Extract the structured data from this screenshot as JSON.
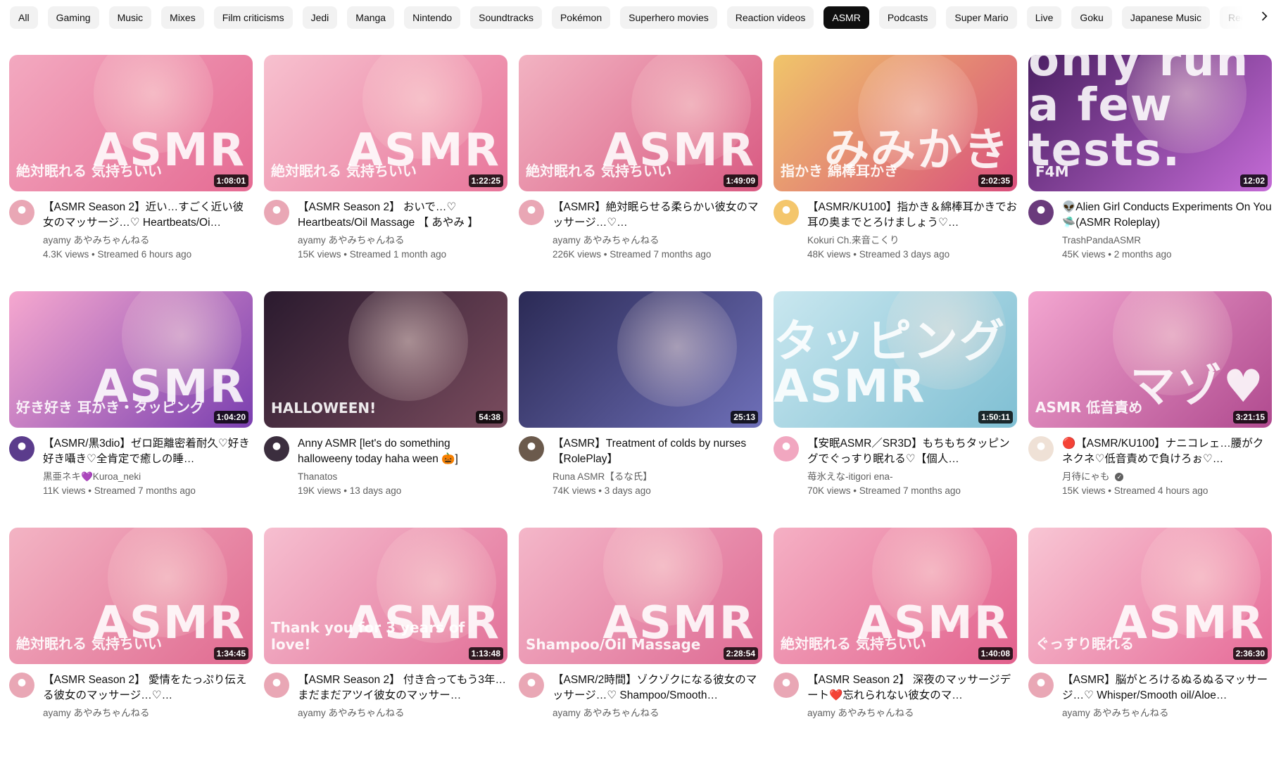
{
  "chips": [
    "All",
    "Gaming",
    "Music",
    "Mixes",
    "Film criticisms",
    "Jedi",
    "Manga",
    "Nintendo",
    "Soundtracks",
    "Pokémon",
    "Superhero movies",
    "Reaction videos",
    "ASMR",
    "Podcasts",
    "Super Mario",
    "Live",
    "Goku",
    "Japanese Music",
    "Rece"
  ],
  "active_chip": "ASMR",
  "videos": [
    {
      "title": "【ASMR Season 2】近い…すごく近い彼女のマッサージ…♡ Heartbeats/Oi…",
      "channel": "ayamy あやみちゃんねる",
      "stats": "4.3K views • Streamed 6 hours ago",
      "duration": "1:08:01",
      "thumb_text": "ASMR",
      "thumb_sub": "絶対眠れる 気持ちいい",
      "thumb_bg": "#f3a9c0",
      "thumb_bg2": "#e56b93",
      "avatar_color": "#e9a7b5"
    },
    {
      "title": "【ASMR Season 2】 おいで…♡ Heartbeats/Oil Massage 【 あやみ 】",
      "channel": "ayamy あやみちゃんねる",
      "stats": "15K views • Streamed 1 month ago",
      "duration": "1:22:25",
      "thumb_text": "ASMR",
      "thumb_sub": "絶対眠れる 気持ちいい",
      "thumb_bg": "#f7c1cf",
      "thumb_bg2": "#e8759a",
      "avatar_color": "#e9a7b5"
    },
    {
      "title": "【ASMR】絶対眠らせる柔らかい彼女のマッサージ…♡…",
      "channel": "ayamy あやみちゃんねる",
      "stats": "226K views • Streamed 7 months ago",
      "duration": "1:49:09",
      "thumb_text": "ASMR",
      "thumb_sub": "絶対眠れる 気持ちいい",
      "thumb_bg": "#f2b3c2",
      "thumb_bg2": "#d95a82",
      "avatar_color": "#e9a7b5"
    },
    {
      "title": "【ASMR/KU100】指かき＆綿棒耳かきでお耳の奥までとろけましょう♡…",
      "channel": "Kokuri Ch.来音こくり",
      "stats": "48K views • Streamed 3 days ago",
      "duration": "2:02:35",
      "thumb_text": "みみかき",
      "thumb_sub": "指かき 綿棒耳かき",
      "thumb_bg": "#f0c56a",
      "thumb_bg2": "#d94f7c",
      "avatar_color": "#f4c66c"
    },
    {
      "title": "👽Alien Girl Conducts Experiments On You 🛸(ASMR Roleplay)",
      "channel": "TrashPandaASMR",
      "stats": "45K views • 2 months ago",
      "duration": "12:02",
      "thumb_text": "Just relax human, we will only run a few tests.",
      "thumb_sub": "F4M",
      "thumb_bg": "#4b1f63",
      "thumb_bg2": "#c46bd6",
      "avatar_color": "#6a3b7c"
    },
    {
      "title": "【ASMR/黒3dio】ゼロ距離密着耐久♡好き好き囁き♡全肯定で癒しの睡…",
      "channel": "黒亜ネキ💜Kuroa_neki",
      "stats": "11K views • Streamed 7 months ago",
      "duration": "1:04:20",
      "thumb_text": "ASMR",
      "thumb_sub": "好き好き 耳かき・タッピング",
      "thumb_bg": "#f6a8cf",
      "thumb_bg2": "#7a3fb0",
      "avatar_color": "#5b3c8c"
    },
    {
      "title": "Anny ASMR [let's do something halloweeny today haha ween 🎃]",
      "channel": "Thanatos",
      "stats": "19K views • 13 days ago",
      "duration": "54:38",
      "thumb_text": "",
      "thumb_sub": "HALLOWEEN!",
      "thumb_bg": "#2a1a2e",
      "thumb_bg2": "#7a4c5e",
      "avatar_color": "#3b2e3e"
    },
    {
      "title": "【ASMR】Treatment of colds by nurses【RolePlay】",
      "channel": "Runa ASMR【るな氏】",
      "stats": "74K views • 3 days ago",
      "duration": "25:13",
      "thumb_text": "",
      "thumb_sub": "",
      "thumb_bg": "#2b2a55",
      "thumb_bg2": "#6e6fb8",
      "avatar_color": "#6b5a4c"
    },
    {
      "title": "【安眠ASMR／SR3D】もちもちタッピングでぐっすり眠れる♡【個人…",
      "channel": "苺氷えな-itigori ena-",
      "stats": "70K views • Streamed 7 months ago",
      "duration": "1:50:11",
      "thumb_text": "タッピング ASMR",
      "thumb_sub": "",
      "thumb_bg": "#c9e7ef",
      "thumb_bg2": "#7fbfd3",
      "avatar_color": "#f1a7c0"
    },
    {
      "title": "🔴【ASMR/KU100】ナニコレェ…腰がクネクネ♡低音責めで負けろぉ♡…",
      "channel": "月待にゃも",
      "stats": "15K views • Streamed 4 hours ago",
      "duration": "3:21:15",
      "thumb_text": "マゾ♥",
      "thumb_sub": "ASMR 低音責め",
      "thumb_bg": "#f3a6d0",
      "thumb_bg2": "#b04a8f",
      "avatar_color": "#efe1d6"
    },
    {
      "title": "【ASMR Season 2】 愛情をたっぷり伝える彼女のマッサージ…♡…",
      "channel": "ayamy あやみちゃんねる",
      "stats": "",
      "duration": "1:34:45",
      "thumb_text": "ASMR",
      "thumb_sub": "絶対眠れる 気持ちいい",
      "thumb_bg": "#f3b4c4",
      "thumb_bg2": "#e06a90",
      "avatar_color": "#e9a7b5"
    },
    {
      "title": "【ASMR Season 2】 付き合ってもう3年…まだまだアツイ彼女のマッサー…",
      "channel": "ayamy あやみちゃんねる",
      "stats": "",
      "duration": "1:13:48",
      "thumb_text": "ASMR",
      "thumb_sub": "Thank you for 3 years of love!",
      "thumb_bg": "#f6bfd0",
      "thumb_bg2": "#e27098",
      "avatar_color": "#e9a7b5"
    },
    {
      "title": "【ASMR/2時間】ゾクゾクになる彼女のマッサージ…♡ Shampoo/Smooth…",
      "channel": "ayamy あやみちゃんねる",
      "stats": "",
      "duration": "2:28:54",
      "thumb_text": "ASMR",
      "thumb_sub": "Shampoo/Oil Massage",
      "thumb_bg": "#f4b7c9",
      "thumb_bg2": "#de6a93",
      "avatar_color": "#e9a7b5"
    },
    {
      "title": "【ASMR Season 2】 深夜のマッサージデート❤️忘れられない彼女のマ…",
      "channel": "ayamy あやみちゃんねる",
      "stats": "",
      "duration": "1:40:08",
      "thumb_text": "ASMR",
      "thumb_sub": "絶対眠れる 気持ちいい",
      "thumb_bg": "#f5b0c4",
      "thumb_bg2": "#e2618d",
      "avatar_color": "#e9a7b5"
    },
    {
      "title": "【ASMR】脳がとろけるぬるぬるマッサージ…♡ Whisper/Smooth oil/Aloe…",
      "channel": "ayamy あやみちゃんねる",
      "stats": "",
      "duration": "2:36:30",
      "thumb_text": "ASMR",
      "thumb_sub": "ぐっすり眠れる",
      "thumb_bg": "#f8c6d4",
      "thumb_bg2": "#e66b98",
      "avatar_color": "#e9a7b5"
    }
  ]
}
